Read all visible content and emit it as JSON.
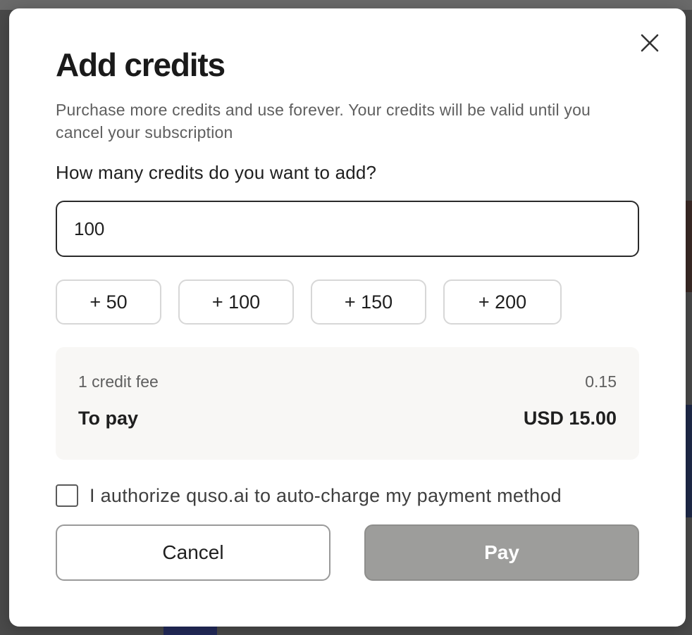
{
  "modal": {
    "title": "Add credits",
    "subtitle": "Purchase more credits and use forever. Your credits will be valid until you cancel your subscription",
    "question": "How many credits do you want to add?",
    "close_icon": "close-icon"
  },
  "credits_input": {
    "value": "100",
    "placeholder": ""
  },
  "quick_add": [
    {
      "label": "+ 50"
    },
    {
      "label": "+ 100"
    },
    {
      "label": "+ 150"
    },
    {
      "label": "+ 200"
    }
  ],
  "summary": {
    "fee_label": "1 credit fee",
    "fee_value": "0.15",
    "pay_label": "To pay",
    "pay_value": "USD 15.00"
  },
  "authorize": {
    "label": "I authorize quso.ai to auto-charge my payment method",
    "checked": false
  },
  "actions": {
    "cancel_label": "Cancel",
    "pay_label": "Pay"
  },
  "colors": {
    "pay_button_disabled": "#9d9d9b",
    "text_primary": "#1f1f1f",
    "text_secondary": "#5f5f5f",
    "summary_bg": "#f8f7f5"
  }
}
